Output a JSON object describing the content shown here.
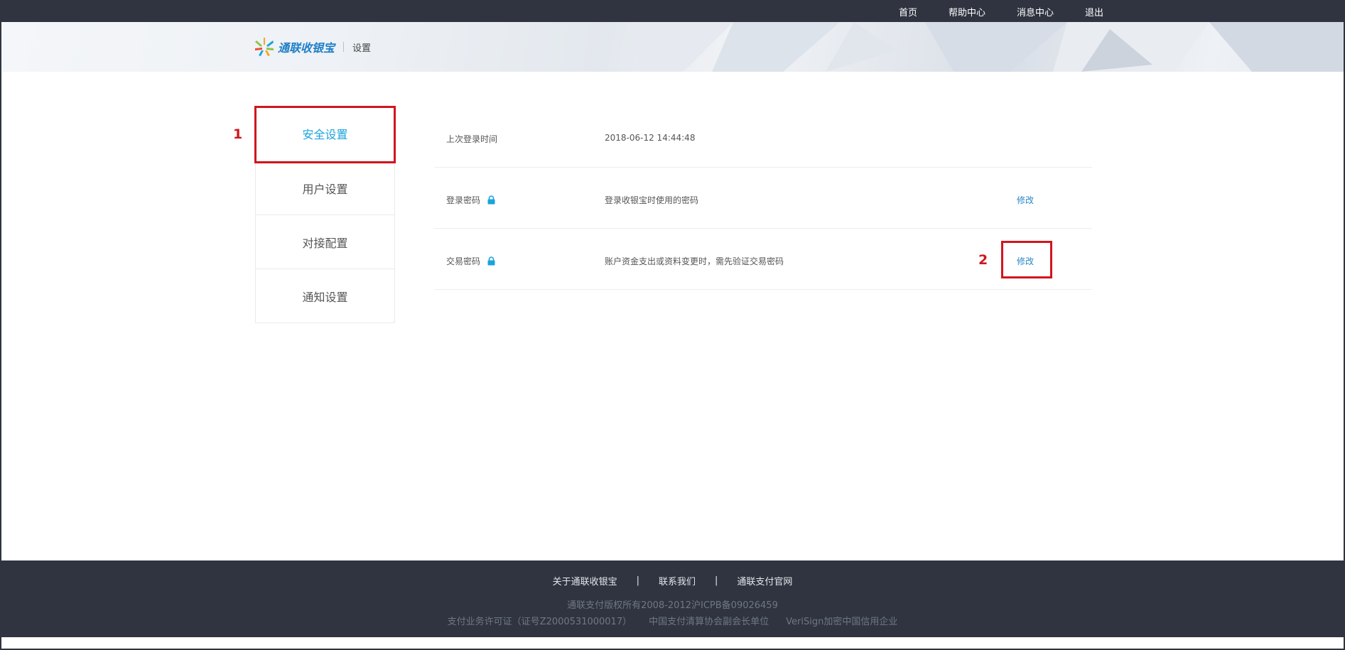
{
  "topnav": {
    "home": "首页",
    "help": "帮助中心",
    "messages": "消息中心",
    "logout": "退出"
  },
  "header": {
    "logo_text": "通联收银宝",
    "page_title": "设置"
  },
  "sidebar": {
    "items": [
      {
        "label": "安全设置",
        "active": true
      },
      {
        "label": "用户设置",
        "active": false
      },
      {
        "label": "对接配置",
        "active": false
      },
      {
        "label": "通知设置",
        "active": false
      }
    ]
  },
  "security": {
    "rows": [
      {
        "label": "上次登录时间",
        "value": "2018-06-12 14:44:48",
        "action": ""
      },
      {
        "label": "登录密码",
        "value": "登录收银宝时使用的密码",
        "action": "修改"
      },
      {
        "label": "交易密码",
        "value": "账户资金支出或资料变更时，需先验证交易密码",
        "action": "修改"
      }
    ]
  },
  "annotations": {
    "marker_1": "1",
    "marker_2": "2"
  },
  "footer": {
    "about": "关于通联收银宝",
    "contact": "联系我们",
    "official": "通联支付官网",
    "separator": "|",
    "copyright": "通联支付版权所有2008-2012沪ICPB备09026459",
    "license": "支付业务许可证（证号Z2000531000017）",
    "association": "中国支付清算协会副会长单位",
    "verisign": "VeriSign加密中国信用企业"
  },
  "colors": {
    "topbar": "#2f3440",
    "accent": "#1aa3dd",
    "link": "#2b86c5",
    "highlight": "#d0161e"
  }
}
